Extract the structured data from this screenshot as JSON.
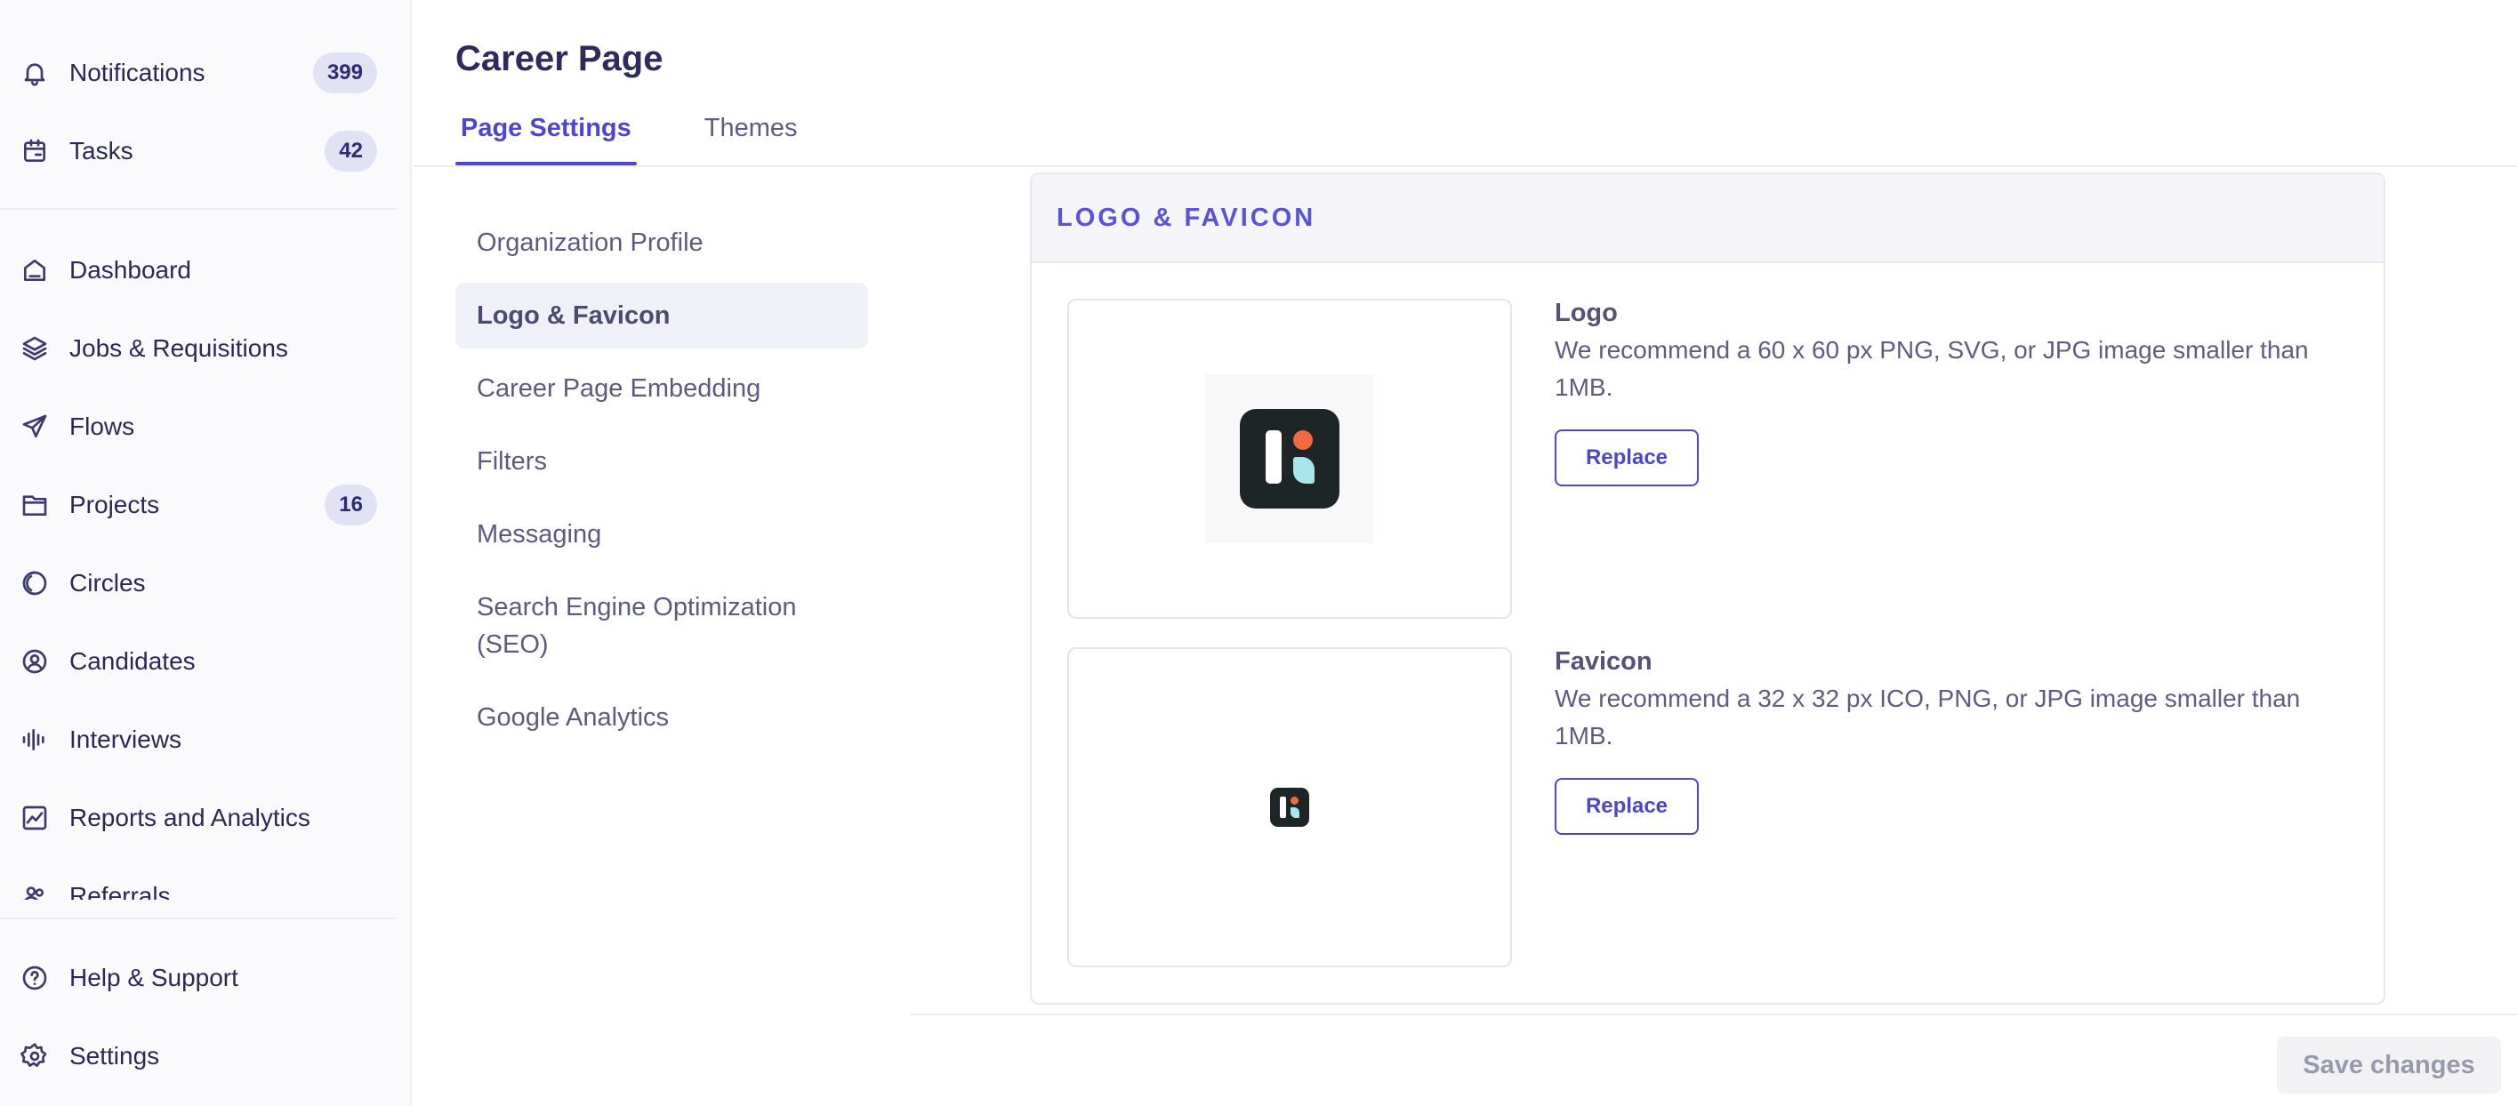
{
  "sidebar": {
    "top_items": [
      {
        "label": "Notifications",
        "badge": "399",
        "icon": "bell-icon"
      },
      {
        "label": "Tasks",
        "badge": "42",
        "icon": "calendar-icon"
      }
    ],
    "items": [
      {
        "label": "Dashboard",
        "icon": "home-icon"
      },
      {
        "label": "Jobs & Requisitions",
        "icon": "layers-icon"
      },
      {
        "label": "Flows",
        "icon": "send-icon"
      },
      {
        "label": "Projects",
        "badge": "16",
        "icon": "folder-icon"
      },
      {
        "label": "Circles",
        "icon": "circles-icon"
      },
      {
        "label": "Candidates",
        "icon": "user-circle-icon"
      },
      {
        "label": "Interviews",
        "icon": "waveform-icon"
      },
      {
        "label": "Reports and Analytics",
        "icon": "chart-icon"
      },
      {
        "label": "Referrals",
        "icon": "referrals-icon"
      }
    ],
    "bottom_items": [
      {
        "label": "Help & Support",
        "icon": "help-icon"
      },
      {
        "label": "Settings",
        "icon": "gear-icon"
      }
    ]
  },
  "header": {
    "title": "Career Page",
    "tabs": [
      {
        "label": "Page Settings",
        "active": true
      },
      {
        "label": "Themes",
        "active": false
      }
    ]
  },
  "subnav": {
    "items": [
      {
        "label": "Organization Profile"
      },
      {
        "label": "Logo & Favicon",
        "active": true
      },
      {
        "label": "Career Page Embedding"
      },
      {
        "label": "Filters"
      },
      {
        "label": "Messaging"
      },
      {
        "label": "Search Engine Optimization (SEO)"
      },
      {
        "label": "Google Analytics"
      }
    ]
  },
  "section": {
    "title": "LOGO & FAVICON",
    "logo": {
      "title": "Logo",
      "description": "We recommend a 60 x 60 px PNG, SVG, or JPG image smaller than 1MB.",
      "button": "Replace"
    },
    "favicon": {
      "title": "Favicon",
      "description": "We recommend a 32 x 32 px ICO, PNG, or JPG image smaller than 1MB.",
      "button": "Replace"
    }
  },
  "footer": {
    "save_label": "Save changes"
  },
  "colors": {
    "accent": "#4f46cf",
    "logo_bg": "#1e2527",
    "logo_dot": "#f06a3f",
    "logo_leaf": "#a9e6ec"
  }
}
